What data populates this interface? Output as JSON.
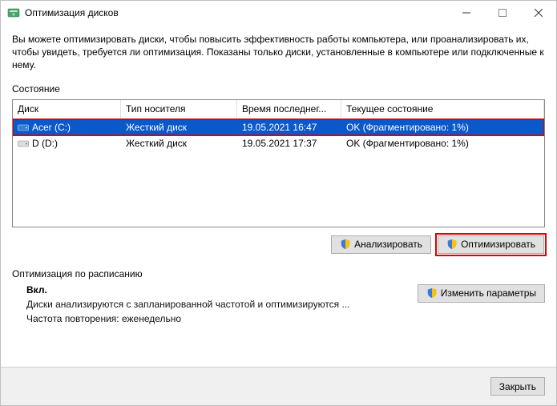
{
  "titlebar": {
    "title": "Оптимизация дисков"
  },
  "intro": "Вы можете оптимизировать диски, чтобы повысить эффективность работы  компьютера, или проанализировать их, чтобы увидеть, требуется ли оптимизация. Показаны только диски, установленные в компьютере или подключенные к нему.",
  "status_label": "Состояние",
  "columns": {
    "disk": "Диск",
    "type": "Тип носителя",
    "time": "Время последнег...",
    "status": "Текущее состояние"
  },
  "rows": [
    {
      "disk": "Acer (C:)",
      "type": "Жесткий диск",
      "time": "19.05.2021 16:47",
      "status": "OK (Фрагментировано: 1%)",
      "selected": true,
      "highlighted": true
    },
    {
      "disk": "D (D:)",
      "type": "Жесткий диск",
      "time": "19.05.2021 17:37",
      "status": "OK (Фрагментировано: 1%)",
      "selected": false,
      "highlighted": false
    }
  ],
  "buttons": {
    "analyze": "Анализировать",
    "optimize": "Оптимизировать",
    "change": "Изменить параметры",
    "close": "Закрыть"
  },
  "schedule": {
    "title": "Оптимизация по расписанию",
    "on": "Вкл.",
    "desc": "Диски анализируются с запланированной частотой и оптимизируются ...",
    "freq": "Частота повторения: еженедельно"
  }
}
